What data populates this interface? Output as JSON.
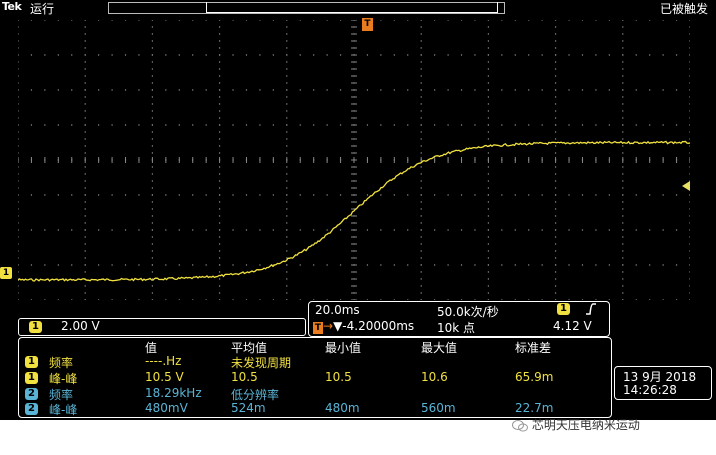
{
  "top": {
    "brand": "Tek",
    "run_state": "运行",
    "trigger_state": "已被触发"
  },
  "markers": {
    "ch1": "1",
    "trigger": "T"
  },
  "colors": {
    "ch1": "#f0e040",
    "ch2": "#5ab4d6",
    "trigger": "#e87c1e",
    "background": "#000000",
    "grid": "#8a8a8a"
  },
  "scale": {
    "ch": "1",
    "volts_per_div": "2.00 V"
  },
  "timebase": {
    "sec_per_div": "20.0ms",
    "sample_rate": "50.0k次/秒",
    "trigger_ch": "1",
    "trigger_slope_icon": "rising-edge-icon",
    "delay": "▼-4.20000ms",
    "record_length": "10k 点",
    "trigger_level": "4.12 V"
  },
  "measurements": {
    "headers": [
      "值",
      "平均值",
      "最小值",
      "最大值",
      "标准差"
    ],
    "rows": [
      {
        "ch": "1",
        "name": "频率",
        "value": "----.Hz",
        "mean": "未发现周期",
        "min": "",
        "max": "",
        "std": ""
      },
      {
        "ch": "1",
        "name": "峰-峰",
        "value": "10.5 V",
        "mean": "10.5",
        "min": "10.5",
        "max": "10.6",
        "std": "65.9m"
      },
      {
        "ch": "2",
        "name": "频率",
        "value": "18.29kHz",
        "mean": "低分辨率",
        "min": "",
        "max": "",
        "std": ""
      },
      {
        "ch": "2",
        "name": "峰-峰",
        "value": "480mV",
        "mean": "524m",
        "min": "480m",
        "max": "560m",
        "std": "22.7m"
      }
    ]
  },
  "datetime": {
    "date": "13 9月  2018",
    "time": "14:26:28"
  },
  "waveform": {
    "ch": "1",
    "low_v": -0.45,
    "high_v": 7.4,
    "rise_center_ms": 0
  },
  "watermark": "芯明天压电纳米运动"
}
